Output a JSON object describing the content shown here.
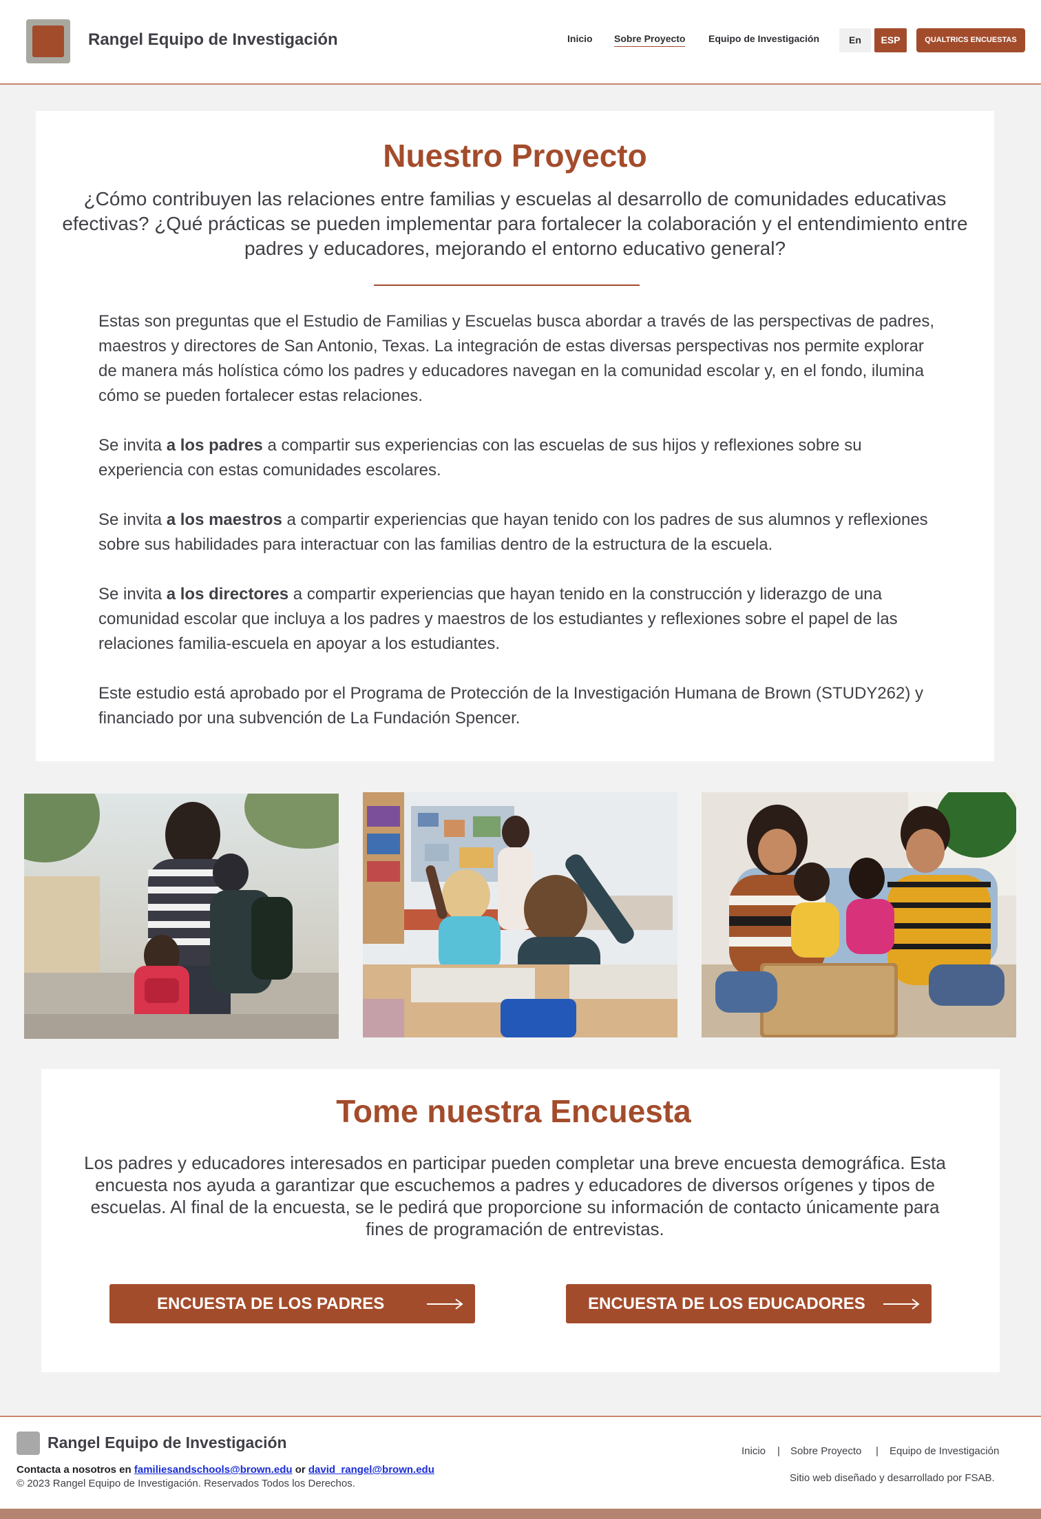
{
  "header": {
    "site_title": "Rangel Equipo de Investigación",
    "nav": {
      "inicio": "Inicio",
      "sobre": "Sobre Proyecto",
      "equipo": "Equipo de Investigación"
    },
    "lang_en": "En",
    "lang_esp": "ESP",
    "qualtrics": "QUALTRICS ENCUESTAS"
  },
  "project": {
    "title": "Nuestro Proyecto",
    "subtitle": "¿Cómo contribuyen las relaciones entre familias y escuelas al desarrollo de comunidades educativas efectivas? ¿Qué prácticas se pueden implementar para fortalecer la colaboración y el entendimiento entre padres y educadores, mejorando el entorno educativo general?",
    "paragraph_1": "Estas son preguntas que el Estudio de Familias y Escuelas busca abordar a través de las perspectivas de padres, maestros y directores de San Antonio, Texas. La integración de estas diversas perspectivas nos permite explorar de manera más holística cómo los padres y educadores navegan en la comunidad escolar y, en el fondo, ilumina cómo se pueden fortalecer estas relaciones.",
    "parents": {
      "prefix": "Se invita ",
      "bold": "a los padres",
      "rest": " a compartir sus experiencias con las escuelas de sus hijos y reflexiones sobre su experiencia con estas comunidades escolares."
    },
    "teachers": {
      "prefix": "Se invita ",
      "bold": "a los maestros",
      "rest": " a compartir experiencias que hayan tenido con los padres de sus alumnos y reflexiones sobre sus habilidades para interactuar con las familias dentro de la estructura de la escuela."
    },
    "directors": {
      "prefix": "Se invita ",
      "bold": "a los directores",
      "rest": " a compartir experiencias que hayan tenido en la construcción y liderazgo de una comunidad escolar que incluya a los padres y maestros de los estudiantes y reflexiones sobre el papel de las relaciones familia-escuela en apoyar a los estudiantes."
    },
    "approval": "Este estudio está aprobado por el Programa de Protección de la Investigación Humana de Brown (STUDY262) y financiado por una subvención de La Fundación Spencer."
  },
  "survey": {
    "title": "Tome nuestra Encuesta",
    "text": "Los padres y educadores interesados en participar pueden completar una breve encuesta demográfica. Esta encuesta nos ayuda a garantizar que escuchemos a padres y educadores de diversos orígenes y tipos de escuelas. Al final de la encuesta, se le pedirá que proporcione su información de contacto únicamente para fines de programación de entrevistas.",
    "parents_button": "ENCUESTA DE LOS PADRES",
    "educators_button": "ENCUESTA DE LOS EDUCADORES"
  },
  "footer": {
    "title": "Rangel Equipo de Investigación",
    "contact_prefix": "Contacta a nosotros en ",
    "email_1": "familiesandschools@brown.edu",
    "contact_or": " or ",
    "email_2": "david_rangel@brown.edu",
    "copyright": "© 2023 Rangel Equipo de Investigación. Reservados Todos los Derechos.",
    "nav": {
      "inicio": "Inicio",
      "sobre": "Sobre Proyecto",
      "equipo": "Equipo de Investigación"
    },
    "separator": "|",
    "credit": "Sitio web diseñado y desarrollado por FSAB."
  },
  "icons": {
    "survey_arrow": "long-right-arrow-icon"
  },
  "colors": {
    "brand": "#a34c2c",
    "accent_line": "#c8866b",
    "background": "#f2f2f2",
    "link": "#1a2ed6"
  }
}
